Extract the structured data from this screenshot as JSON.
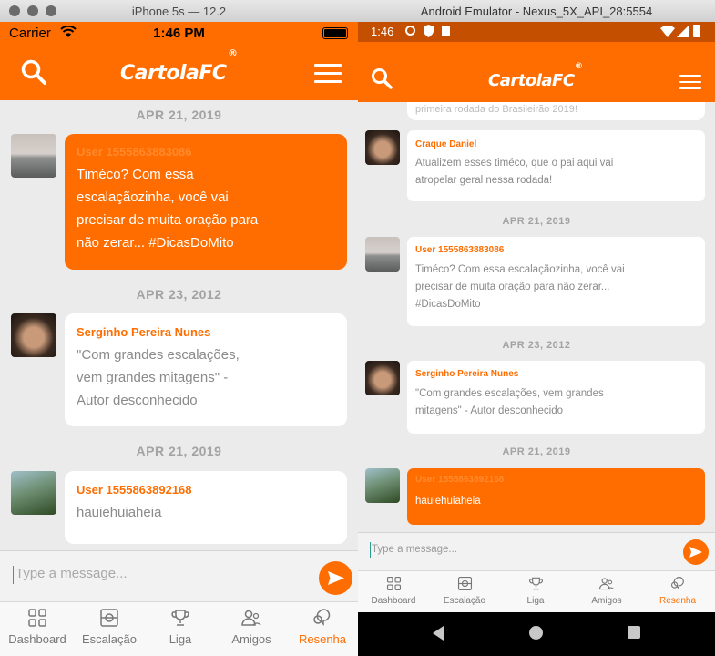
{
  "ios_window": {
    "title": "iPhone 5s — 12.2",
    "status": {
      "carrier": "Carrier",
      "time": "1:46 PM"
    },
    "logo": {
      "text": "CartolaFC",
      "mark": "®"
    },
    "messages": [
      {
        "date": "APR 21, 2019",
        "user": "User 1555863883086",
        "text_lines": [
          "Timéco? Com essa",
          "escalaçãozinha, você vai",
          "precisar de muita oração para",
          "não zerar... #DicasDoMito"
        ],
        "style": "orange"
      },
      {
        "date": "APR 23, 2012",
        "user": "Serginho Pereira Nunes",
        "text_lines": [
          "\"Com grandes escalações,",
          "vem grandes mitagens\" -",
          "Autor desconhecido"
        ],
        "style": "white"
      },
      {
        "date": "APR 21, 2019",
        "user": "User 1555863892168",
        "text_lines": [
          "hauiehuiahei​a"
        ],
        "style": "white"
      }
    ],
    "input_placeholder": "Type a message...",
    "tabs": [
      "Dashboard",
      "Escalação",
      "Liga",
      "Amigos",
      "Resenha"
    ]
  },
  "android_window": {
    "title": "Android Emulator - Nexus_5X_API_28:5554",
    "status": {
      "time": "1:46"
    },
    "logo": {
      "text": "CartolaFC",
      "mark": "®"
    },
    "partial_top_text": "primeira rodada do Brasileirão 2019!",
    "messages": [
      {
        "date": "",
        "user": "Craque Daniel",
        "text_lines": [
          "Atualizem esses timéco, que o pai aqui vai",
          "atropelar geral nessa rodada!"
        ],
        "style": "white"
      },
      {
        "date": "APR 21, 2019",
        "user": "User 1555863883086",
        "text_lines": [
          "Timéco? Com essa escalaçãozinha, você vai",
          "precisar de muita oração para não zerar...",
          "#DicasDoMito"
        ],
        "style": "white"
      },
      {
        "date": "APR 23, 2012",
        "user": "Serginho Pereira Nunes",
        "text_lines": [
          "\"Com grandes escalações, vem grandes",
          "mitagens\" - Autor desconhecido"
        ],
        "style": "white"
      },
      {
        "date": "APR 21, 2019",
        "user": "User 1555863892168",
        "text_lines": [
          "hauiehuiahei​a"
        ],
        "style": "orange"
      }
    ],
    "input_placeholder": "Type a message...",
    "tabs": [
      "Dashboard",
      "Escalação",
      "Liga",
      "Amigos",
      "Resenha"
    ]
  },
  "colors": {
    "accent": "#ff6d00",
    "background": "#ebebeb",
    "muted_text": "#8a8a8a",
    "date_text": "#a3a3a3"
  }
}
